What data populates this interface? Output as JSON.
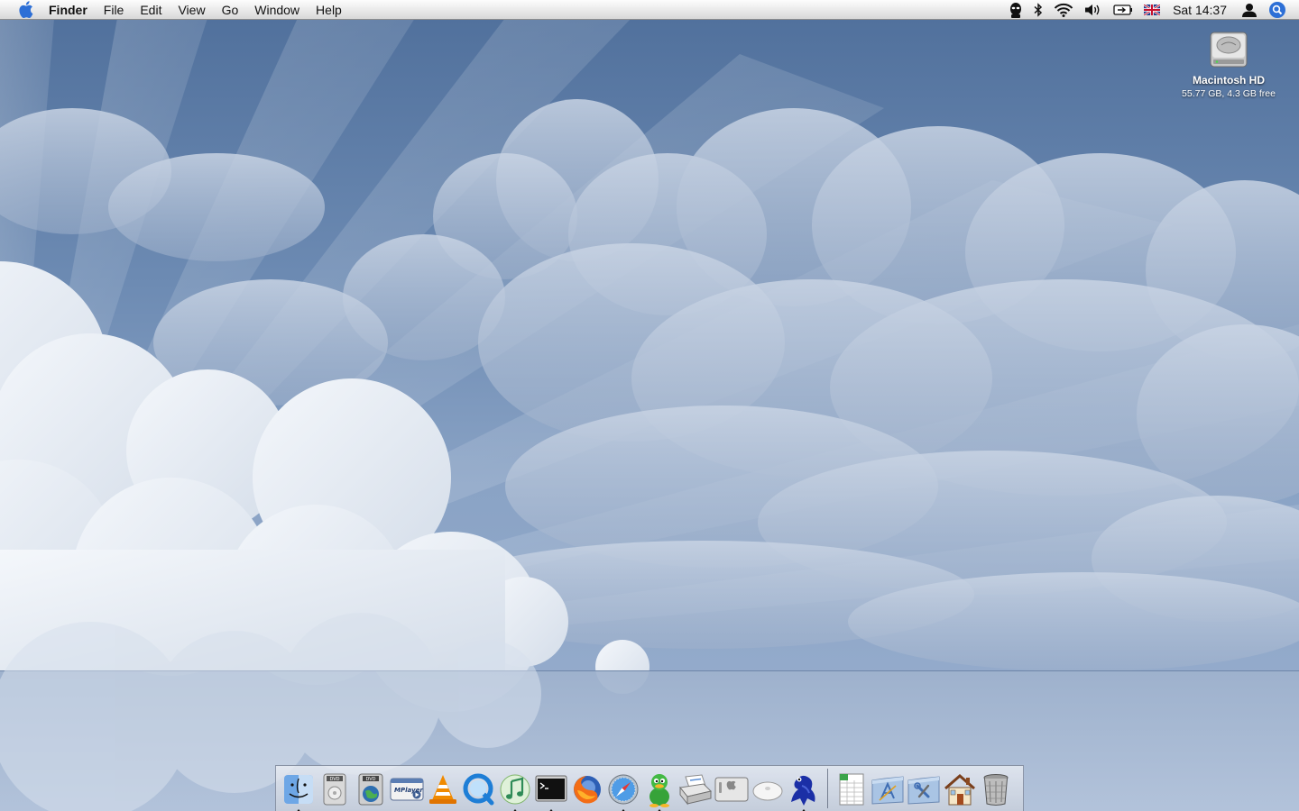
{
  "menubar": {
    "apple_icon": "apple-logo-icon",
    "app_name": "Finder",
    "menus": [
      "File",
      "Edit",
      "View",
      "Go",
      "Window",
      "Help"
    ],
    "status_icons": [
      "alien-icon",
      "bluetooth-icon",
      "wifi-icon",
      "volume-icon",
      "battery-icon",
      "uk-flag-icon"
    ],
    "clock": "Sat 14:37",
    "user_icon": "user-icon",
    "spotlight_icon": "spotlight-icon",
    "accent_color": "#2d6fd6"
  },
  "desktop": {
    "drive": {
      "name": "Macintosh HD",
      "info": "55.77 GB, 4.3 GB free",
      "icon": "hard-drive-icon"
    },
    "wallpaper_colors": {
      "sky_top": "#4f6f9b",
      "sky_bottom": "#a2b6d3",
      "cloud": "#e8eef6"
    }
  },
  "dock": {
    "apps": [
      {
        "icon": "finder-icon",
        "running": true
      },
      {
        "icon": "dvd-player-icon",
        "running": false
      },
      {
        "icon": "dvd-globe-icon",
        "running": false
      },
      {
        "icon": "mplayer-icon",
        "running": false
      },
      {
        "icon": "vlc-cone-icon",
        "running": false
      },
      {
        "icon": "quicktime-icon",
        "running": false
      },
      {
        "icon": "itunes-icon",
        "running": true
      },
      {
        "icon": "terminal-icon",
        "running": true
      },
      {
        "icon": "firefox-icon",
        "running": false
      },
      {
        "icon": "safari-compass-icon",
        "running": true
      },
      {
        "icon": "adium-duck-icon",
        "running": true
      },
      {
        "icon": "printer-icon",
        "running": false
      },
      {
        "icon": "system-profiler-icon",
        "running": false
      },
      {
        "icon": "mouse-icon",
        "running": false
      },
      {
        "icon": "frog-icon",
        "running": true
      }
    ],
    "documents": [
      {
        "icon": "spreadsheet-icon",
        "running": false
      },
      {
        "icon": "applications-folder-icon",
        "running": false
      },
      {
        "icon": "utilities-folder-icon",
        "running": false
      },
      {
        "icon": "home-folder-icon",
        "running": false
      },
      {
        "icon": "trash-icon",
        "running": false
      }
    ],
    "mplayer_label": "MPlayer"
  }
}
